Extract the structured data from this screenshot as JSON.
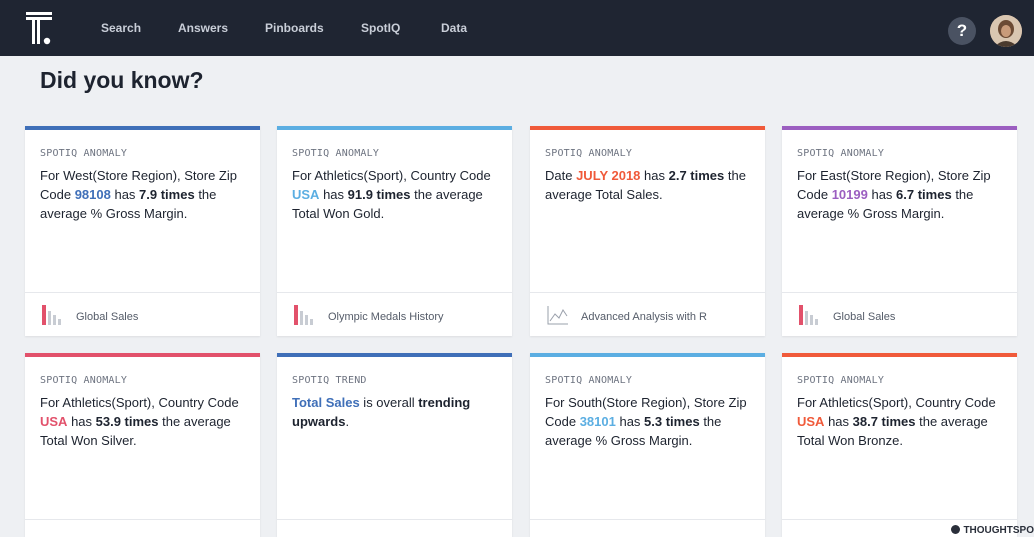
{
  "nav": {
    "items": [
      "Search",
      "Answers",
      "Pinboards",
      "SpotIQ",
      "Data"
    ],
    "help_label": "?"
  },
  "page": {
    "title": "Did you know?"
  },
  "colors": {
    "blue_dark": "#3f6fb8",
    "blue_light": "#5baee2",
    "red": "#f05a3a",
    "purple": "#9b5ec0",
    "pink": "#e2516b"
  },
  "cards": [
    {
      "type": "SpotIQ Anomaly",
      "accent": "#3f6fb8",
      "text_pre": "For West(Store Region), Store Zip Code ",
      "highlight": "98108",
      "highlight_color": "#3f6fb8",
      "text_mid": " has ",
      "times": "7.9 times",
      "text_post": " the average % Gross Margin.",
      "footer": {
        "icon": "bar-chart-icon",
        "label": "Global Sales"
      }
    },
    {
      "type": "SpotIQ Anomaly",
      "accent": "#5baee2",
      "text_pre": "For Athletics(Sport), Country Code ",
      "highlight": "USA",
      "highlight_color": "#5baee2",
      "text_mid": " has ",
      "times": "91.9 times",
      "text_post": " the average Total Won Gold.",
      "footer": {
        "icon": "bar-chart-icon",
        "label": "Olympic Medals History"
      }
    },
    {
      "type": "SpotIQ Anomaly",
      "accent": "#f05a3a",
      "text_pre": "Date ",
      "highlight": "JULY 2018",
      "highlight_color": "#f05a3a",
      "text_mid": " has ",
      "times": "2.7 times",
      "text_post": " the average Total Sales.",
      "footer": {
        "icon": "line-chart-icon",
        "label": "Advanced Analysis with R"
      }
    },
    {
      "type": "SpotIQ Anomaly",
      "accent": "#9b5ec0",
      "text_pre": "For East(Store Region), Store Zip Code ",
      "highlight": "10199",
      "highlight_color": "#9b5ec0",
      "text_mid": " has ",
      "times": "6.7 times",
      "text_post": " the average % Gross Margin.",
      "footer": {
        "icon": "bar-chart-icon",
        "label": "Global Sales"
      }
    },
    {
      "type": "SpotIQ Anomaly",
      "accent": "#e2516b",
      "text_pre": "For Athletics(Sport), Country Code ",
      "highlight": "USA",
      "highlight_color": "#e2516b",
      "text_mid": " has ",
      "times": "53.9 times",
      "text_post": " the average Total Won Silver."
    },
    {
      "type": "SpotIQ Trend",
      "accent": "#3f6fb8",
      "trend_metric": "Total Sales",
      "trend_metric_color": "#3f6fb8",
      "trend_mid": " is overall ",
      "trend_word": "trending upwards",
      "trend_end": "."
    },
    {
      "type": "SpotIQ Anomaly",
      "accent": "#5baee2",
      "text_pre": "For South(Store Region), Store Zip Code ",
      "highlight": "38101",
      "highlight_color": "#5baee2",
      "text_mid": " has ",
      "times": "5.3 times",
      "text_post": " the average % Gross Margin."
    },
    {
      "type": "SpotIQ Anomaly",
      "accent": "#f05a3a",
      "text_pre": "For Athletics(Sport), Country Code ",
      "highlight": "USA",
      "highlight_color": "#f05a3a",
      "text_mid": " has ",
      "times": "38.7 times",
      "text_post": " the average Total Won Bronze."
    }
  ],
  "brand": "THOUGHTSPO"
}
